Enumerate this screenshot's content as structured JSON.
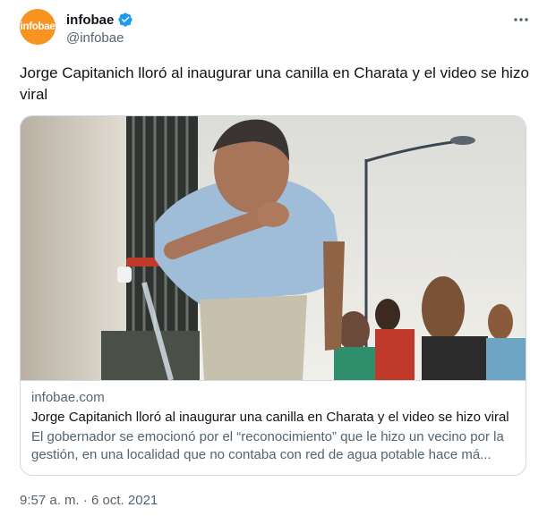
{
  "tweet": {
    "avatar_text": "infobae",
    "display_name": "infobae",
    "handle": "@infobae",
    "text": "Jorge Capitanich lloró al inaugurar una canilla en Charata y el video se hizo viral",
    "more_icon": "more-horizontal-icon",
    "verified_icon": "verified-badge-icon",
    "timestamp": "9:57 a. m. · 6 oct. 2021"
  },
  "card": {
    "domain": "infobae.com",
    "title": "Jorge Capitanich lloró al inaugurar una canilla en Charata y el video se hizo viral",
    "description": "El gobernador se emocionó por el “reconocimiento” que le hizo un vecino por la gestión, en una localidad que no contaba con red de agua potable hace má..."
  },
  "colors": {
    "brand": "#f7931e",
    "verified": "#1d9bf0",
    "secondary_text": "#536471",
    "border": "#cfd9de"
  }
}
